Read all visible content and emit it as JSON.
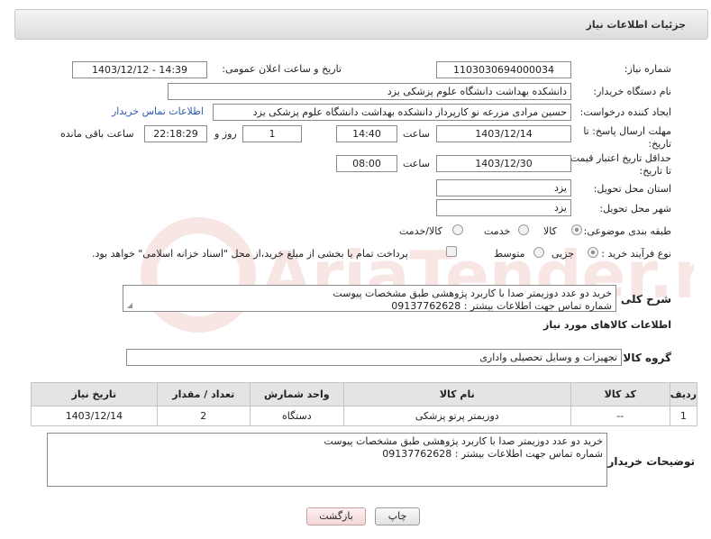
{
  "header": {
    "title": "جزئیات اطلاعات نیاز"
  },
  "fields": {
    "need_number_label": "شماره نیاز:",
    "need_number": "1103030694000034",
    "announce_label": "تاریخ و ساعت اعلان عمومی:",
    "announce_value": "1403/12/12 - 14:39",
    "buyer_org_label": "نام دستگاه خریدار:",
    "buyer_org": "دانشکده بهداشت دانشگاه علوم پزشکی یزد",
    "requester_label": "ایجاد کننده درخواست:",
    "requester": "حسین مرادی مزرعه نو کارپرداز دانشکده بهداشت دانشگاه علوم پزشکی یزد",
    "contact_link": "اطلاعات تماس خریدار",
    "deadline_label": "مهلت ارسال پاسخ: تا تاریخ:",
    "deadline_date": "1403/12/14",
    "time_label": "ساعت",
    "deadline_time": "14:40",
    "days_value": "1",
    "days_label": "روز و",
    "remaining_time": "22:18:29",
    "remaining_label": "ساعت باقی مانده",
    "validity_label": "حداقل تاریخ اعتبار قیمت: تا تاریخ:",
    "validity_date": "1403/12/30",
    "validity_time": "08:00",
    "province_label": "استان محل تحویل:",
    "province": "یزد",
    "city_label": "شهر محل تحویل:",
    "city": "یزد",
    "category_label": "طبقه بندی موضوعی:",
    "category_options": [
      "کالا",
      "خدمت",
      "کالا/خدمت"
    ],
    "process_label": "نوع فرآیند خرید :",
    "process_options": [
      "جزیی",
      "متوسط"
    ],
    "payment_note": "پرداخت تمام یا بخشی از مبلغ خرید،از محل \"اسناد خزانه اسلامی\" خواهد بود."
  },
  "description": {
    "label": "شرح کلی نیاز:",
    "line1": "خرید دو عدد دوزیمتر صدا با کاربرد پژوهشی طبق مشخصات پیوست",
    "line2": "شماره تماس جهت اطلاعات بیشتر : 09137762628"
  },
  "goods": {
    "section_title": "اطلاعات کالاهای مورد نیاز",
    "group_label": "گروه کالا:",
    "group_value": "تجهیزات و وسایل تحصیلی واداری",
    "columns": [
      "ردیف",
      "کد کالا",
      "نام کالا",
      "واحد شمارش",
      "تعداد / مقدار",
      "تاریخ نیاز"
    ],
    "rows": [
      [
        "1",
        "--",
        "دوزیمتر پرتو پزشکی",
        "دستگاه",
        "2",
        "1403/12/14"
      ]
    ]
  },
  "buyer_notes": {
    "label": "توضیحات خریدار:",
    "line1": "خرید دو عدد دوزیمتر صدا با کاربرد پژوهشی طبق مشخصات پیوست",
    "line2": "شماره تماس جهت اطلاعات بیشتر : 09137762628"
  },
  "buttons": {
    "print": "چاپ",
    "back": "بازگشت"
  },
  "watermark_text": "AriaTender.net"
}
